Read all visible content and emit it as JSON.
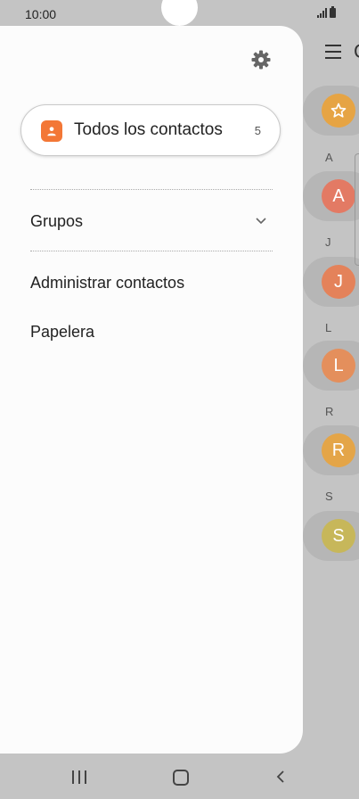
{
  "status_bar": {
    "time": "10:00"
  },
  "background": {
    "header_partial": "C",
    "sections": [
      {
        "letter": "A",
        "initial": "A",
        "color": "#e37a64"
      },
      {
        "letter": "J",
        "initial": "J",
        "color": "#e4825a"
      },
      {
        "letter": "L",
        "initial": "L",
        "color": "#e48f5c"
      },
      {
        "letter": "R",
        "initial": "R",
        "color": "#e4a548"
      },
      {
        "letter": "S",
        "initial": "S",
        "color": "#c7b75a"
      }
    ],
    "favorite_color": "#e6a444"
  },
  "drawer": {
    "all_contacts": {
      "label": "Todos los contactos",
      "count": "5",
      "icon_color": "#f37736"
    },
    "groups_label": "Grupos",
    "manage_label": "Administrar contactos",
    "trash_label": "Papelera"
  },
  "icons": {
    "settings": "gear-icon",
    "menu": "menu-icon",
    "chevron": "chevron-down-icon",
    "favorite": "star-icon",
    "all_contacts": "person-icon"
  }
}
